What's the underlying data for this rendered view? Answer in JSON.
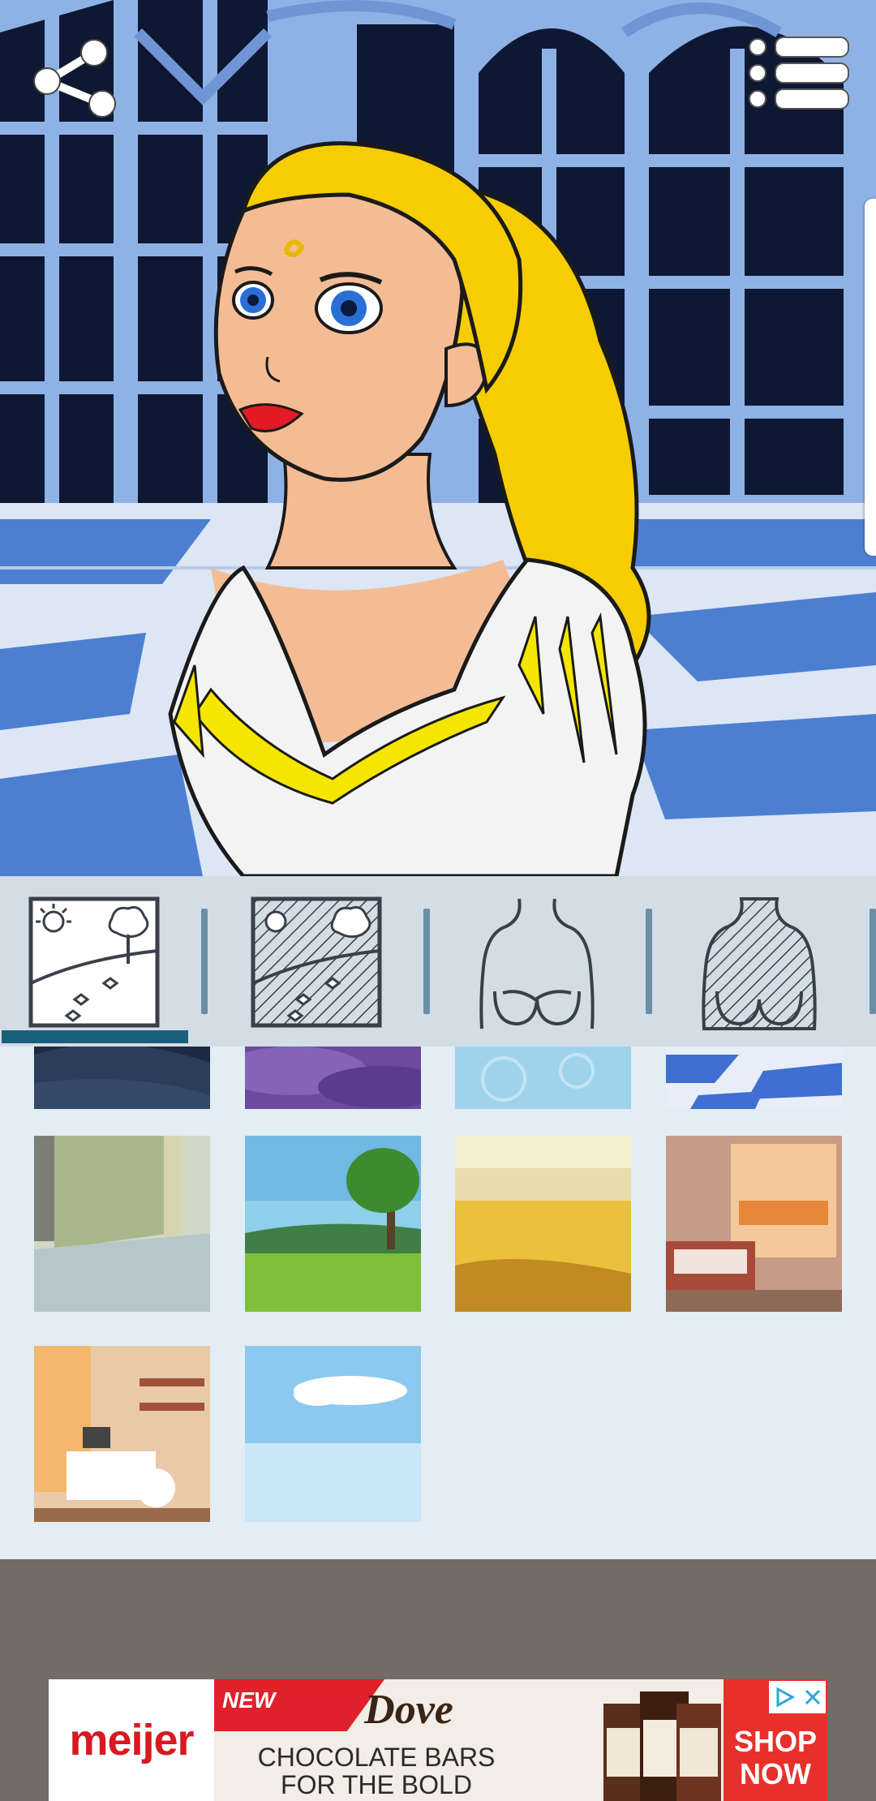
{
  "toolbar": {
    "share_icon": "share-icon",
    "menu_icon": "list-menu-icon"
  },
  "tabs": [
    {
      "name": "background",
      "icon": "landscape-icon",
      "selected": true
    },
    {
      "name": "background-color",
      "icon": "landscape-shaded-icon",
      "selected": false
    },
    {
      "name": "body",
      "icon": "torso-icon",
      "selected": false
    },
    {
      "name": "body-color",
      "icon": "torso-shaded-icon",
      "selected": false
    }
  ],
  "thumbnails": [
    {
      "name": "night-field",
      "row": 0
    },
    {
      "name": "purple-clouds",
      "row": 0
    },
    {
      "name": "light-blue-pattern",
      "row": 0
    },
    {
      "name": "checkered-floor",
      "row": 0
    },
    {
      "name": "stone-wall",
      "row": 1
    },
    {
      "name": "meadow-tree",
      "row": 1
    },
    {
      "name": "desert",
      "row": 1
    },
    {
      "name": "bedroom-sunset",
      "row": 1
    },
    {
      "name": "kids-room",
      "row": 2
    },
    {
      "name": "blue-sky",
      "row": 2
    }
  ],
  "ad": {
    "brand": "meijer",
    "badge": "NEW",
    "product_logo": "Dove",
    "headline_line1": "CHOCOLATE BARS",
    "headline_line2": "FOR THE BOLD",
    "cta_line1": "SHOP",
    "cta_line2": "NOW",
    "colors": {
      "brand_red": "#d71920",
      "cta_red": "#e8302a"
    }
  },
  "colors": {
    "tab_indicator": "#1a5f7e",
    "tab_bar_bg": "#d3dde5",
    "grid_bg": "#e2edf4",
    "bottom_bg": "#736b66"
  }
}
